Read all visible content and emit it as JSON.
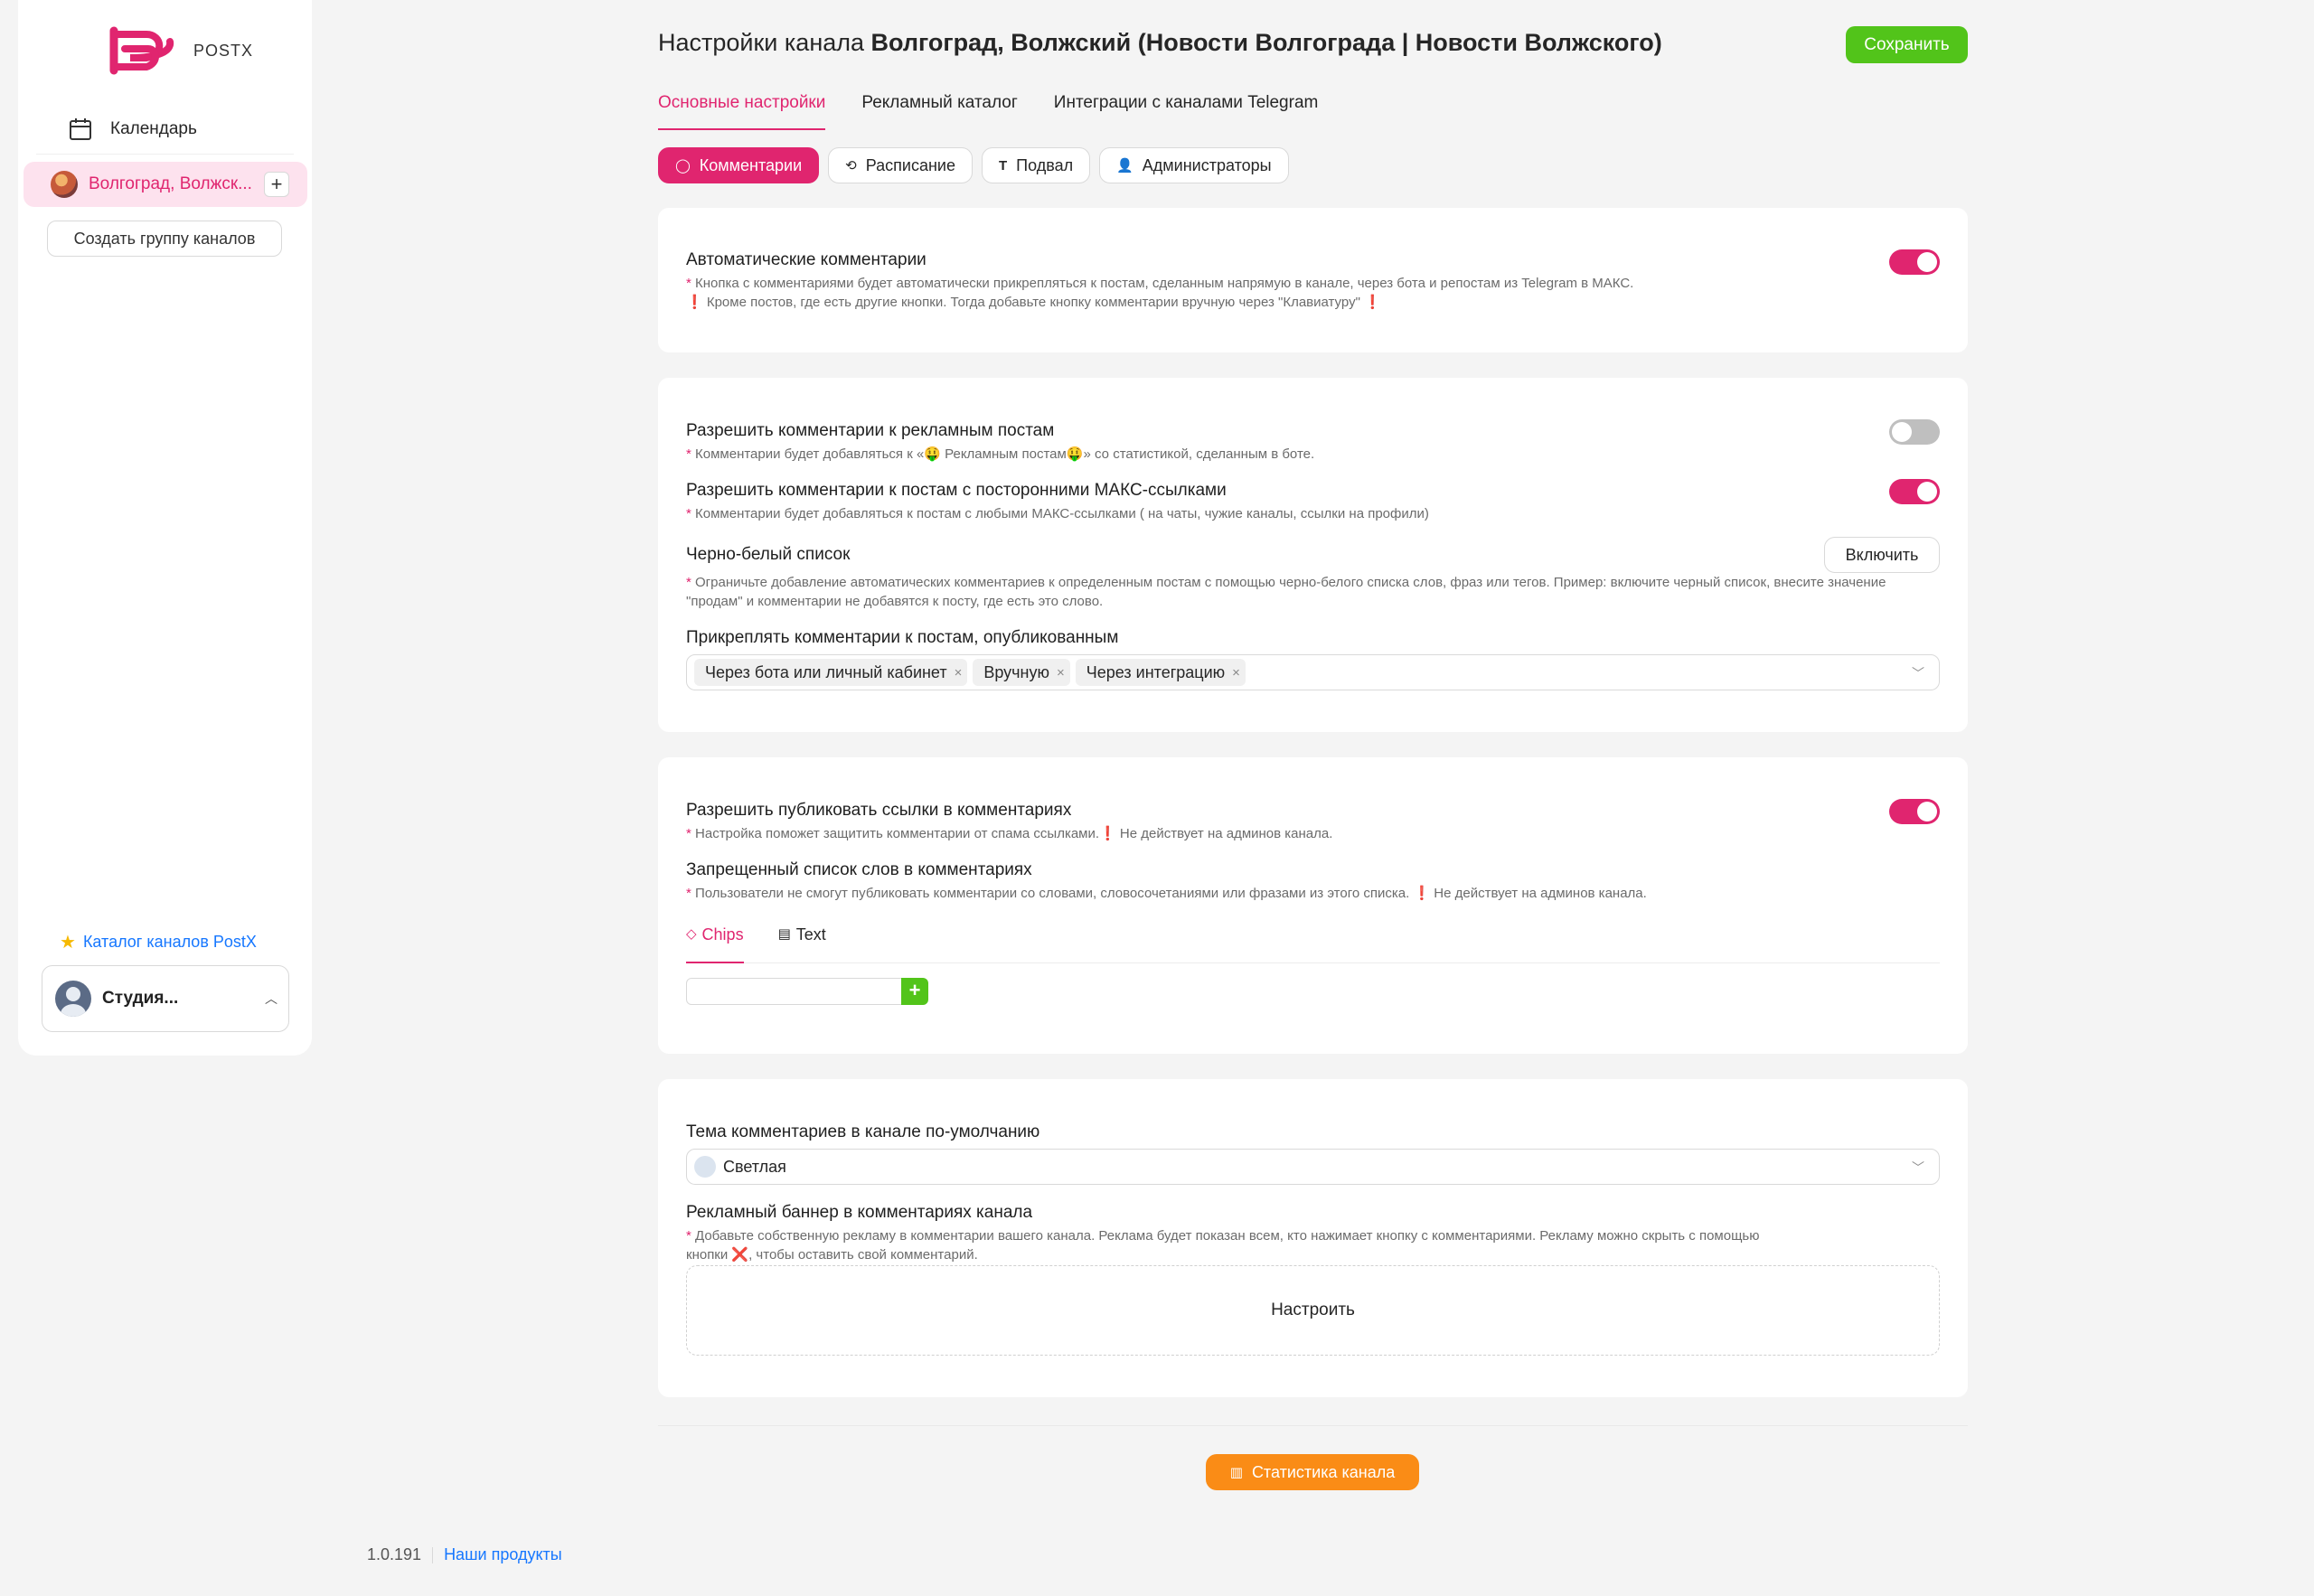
{
  "app": {
    "brand": "POSTX"
  },
  "sidebar": {
    "calendar_label": "Календарь",
    "channel_label": "Волгоград, Волжск...",
    "add_symbol": "+",
    "create_group_label": "Создать группу каналов",
    "catalog_link": "Каталог каналов PostX",
    "profile_name": "Студия..."
  },
  "header": {
    "title_prefix": "Настройки канала ",
    "title_channel": "Волгоград, Волжский (Новости Волгограда | Новости Волжского)",
    "save_label": "Сохранить"
  },
  "tabs": [
    {
      "label": "Основные настройки",
      "active": true
    },
    {
      "label": "Рекламный каталог",
      "active": false
    },
    {
      "label": "Интеграции с каналами Telegram",
      "active": false
    }
  ],
  "subtabs": [
    {
      "label": "Комментарии",
      "icon": "comment-icon",
      "active": true
    },
    {
      "label": "Расписание",
      "icon": "schedule-icon",
      "active": false
    },
    {
      "label": "Подвал",
      "icon": "text-icon",
      "active": false
    },
    {
      "label": "Администраторы",
      "icon": "admin-icon",
      "active": false
    }
  ],
  "auto_comments": {
    "title": "Автоматические комментарии",
    "desc1": "Кнопка с комментариями будет автоматически прикрепляться к постам, сделанным напрямую в канале, через бота и репостам из Telegram в МАКС.",
    "desc2": " Кроме постов, где есть другие кнопки. Тогда добавьте кнопку комментарии вручную через \"Клавиатуру\" ",
    "enabled": true
  },
  "ads": {
    "title": "Разрешить комментарии к рекламным постам",
    "desc": "Комментарии будет добавляться к «🤑 Рекламным постам🤑» со статистикой, сделанным в боте.",
    "enabled": false
  },
  "max_links": {
    "title": "Разрешить комментарии к постам с посторонними МАКС-ссылками",
    "desc": "Комментарии будет добавляться к постам с любыми МАКС-ссылками ( на чаты, чужие каналы, ссылки на профили)",
    "enabled": true
  },
  "bw_list": {
    "title": "Черно-белый список",
    "desc": "Ограничьте добавление автоматических комментариев к определенным постам с помощью черно-белого списка слов, фраз или тегов. Пример: включите черный список, внесите значение \"продам\" и комментарии не добавятся к посту, где есть это слово.",
    "button": "Включить"
  },
  "attach": {
    "title": "Прикреплять комментарии к постам, опубликованным",
    "tags": [
      "Через бота или личный кабинет",
      "Вручную",
      "Через интеграцию"
    ],
    "remove_symbol": "×"
  },
  "links": {
    "title": "Разрешить публиковать ссылки в комментариях",
    "desc": "Настройка поможет защитить комментарии от спама ссылками.",
    "desc_note": " Не действует на админов канала.",
    "enabled": true
  },
  "banned": {
    "title": "Запрещенный список слов в комментариях",
    "desc": "Пользователи не смогут публиковать комментарии со словами, словосочетаниями или фразами из этого списка. ",
    "desc_note": " Не действует на админов канала.",
    "tab_chips": "Chips",
    "tab_text": "Text",
    "add_symbol": "+"
  },
  "theme": {
    "title": "Тема комментариев в канале по-умолчанию",
    "value": "Светлая"
  },
  "banner": {
    "title": "Рекламный баннер в комментариях канала",
    "desc1": "Добавьте собственную рекламу в комментарии вашего канала. Реклама будет показан всем, кто нажимает кнопку с комментариями. Рекламу можно скрыть с помощью",
    "desc2": "кнопки ❌, чтобы оставить свой комментарий.",
    "button": "Настроить"
  },
  "stats_label": "Статистика канала",
  "footer": {
    "version": "1.0.191",
    "products_link": "Наши продукты"
  },
  "colors": {
    "accent": "#e0256f",
    "save": "#52c41a",
    "stats": "#fa8c16",
    "link": "#1677ff"
  }
}
